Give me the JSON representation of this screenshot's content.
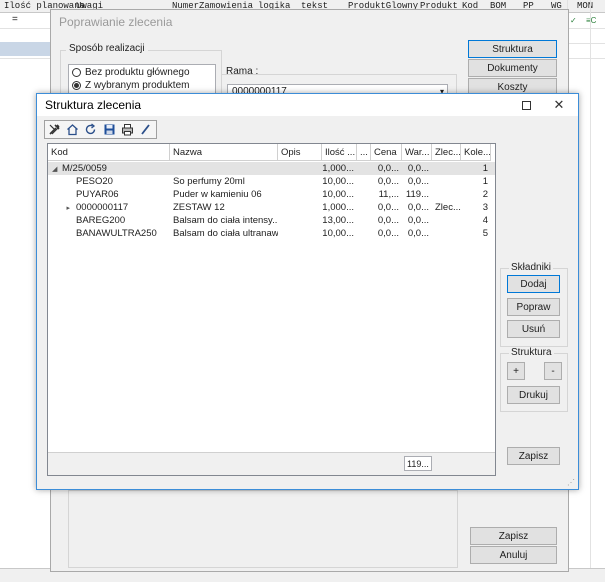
{
  "spreadsheet": {
    "headers": [
      "Ilość planowana",
      "Uwagi",
      "NumerZamowienia",
      "logika",
      "tekst",
      "ProduktGlowny",
      "Produkt",
      "Kod",
      "BOM",
      "PP",
      "WG",
      "MON"
    ],
    "row_marker": "=",
    "right_cells": [
      "✓",
      "≡C"
    ]
  },
  "back_dialog": {
    "title": "Poprawianie zlecenia",
    "sposob_label": "Sposób realizacji",
    "radio_options": [
      {
        "label": "Bez produktu głównego",
        "selected": false
      },
      {
        "label": "Z wybranym produktem",
        "selected": true
      }
    ],
    "rama_label": "Rama :",
    "rama_value": "0000000117",
    "buttons": {
      "struktura": "Struktura",
      "dokumenty": "Dokumenty",
      "koszty": "Koszty",
      "zapisz": "Zapisz",
      "anuluj": "Anuluj"
    }
  },
  "front_dialog": {
    "title": "Struktura zlecenia",
    "toolbar_icons": [
      "tools-icon",
      "home-icon",
      "refresh-icon",
      "save-icon",
      "print-icon",
      "edit-icon"
    ],
    "columns": [
      "Kod",
      "Nazwa",
      "Opis",
      "Ilość ...",
      "...",
      "Cena",
      "War...",
      "Zlec...",
      "Kole..."
    ],
    "rows": [
      {
        "expander": "◢",
        "kod": "M/25/0059",
        "nazwa": "",
        "opis": "",
        "ilosc": "1,000...",
        "x": "",
        "cena": "0,0...",
        "war": "0,0...",
        "zlec": "",
        "kole": "1",
        "selected": true
      },
      {
        "expander": "",
        "kod": "PESO20",
        "nazwa": "So perfumy 20ml",
        "opis": "",
        "ilosc": "10,00...",
        "x": "",
        "cena": "0,0...",
        "war": "0,0...",
        "zlec": "",
        "kole": "1",
        "selected": false
      },
      {
        "expander": "",
        "kod": "PUYAR06",
        "nazwa": "Puder w kamieniu 06",
        "opis": "",
        "ilosc": "10,00...",
        "x": "",
        "cena": "11,...",
        "war": "119...",
        "zlec": "",
        "kole": "2",
        "selected": false
      },
      {
        "expander": "▸",
        "kod": "0000000117",
        "nazwa": "ZESTAW 12",
        "opis": "",
        "ilosc": "1,000...",
        "x": "",
        "cena": "0,0...",
        "war": "0,0...",
        "zlec": "Zlec...",
        "kole": "3",
        "selected": false
      },
      {
        "expander": "",
        "kod": "BAREG200",
        "nazwa": "Balsam do ciała intensy...",
        "opis": "",
        "ilosc": "13,00...",
        "x": "",
        "cena": "0,0...",
        "war": "0,0...",
        "zlec": "",
        "kole": "4",
        "selected": false
      },
      {
        "expander": "",
        "kod": "BANAWULTRA250",
        "nazwa": "Balsam do ciała ultranaw...",
        "opis": "",
        "ilosc": "10,00...",
        "x": "",
        "cena": "0,0...",
        "war": "0,0...",
        "zlec": "",
        "kole": "5",
        "selected": false
      }
    ],
    "footer_total": "119...",
    "skladniki_label": "Składniki",
    "struktura_label": "Struktura",
    "buttons": {
      "dodaj": "Dodaj",
      "popraw": "Popraw",
      "usun": "Usuń",
      "plus": "+",
      "minus": "-",
      "drukuj": "Drukuj",
      "zapisz": "Zapisz"
    }
  }
}
